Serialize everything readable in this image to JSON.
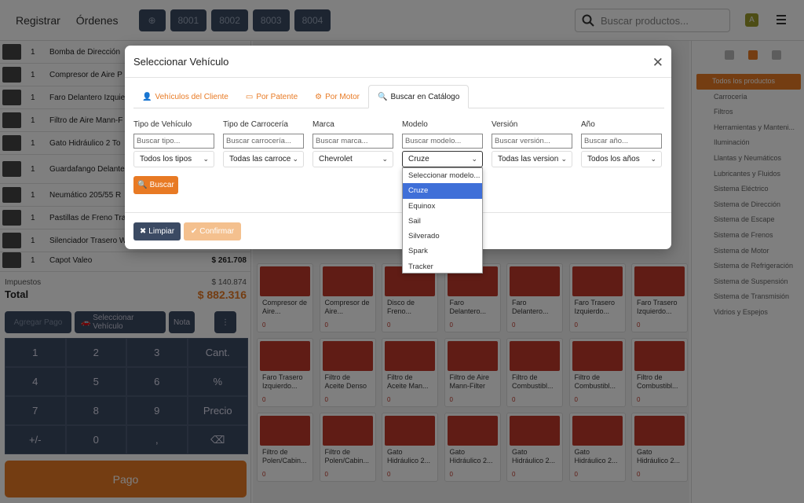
{
  "topbar": {
    "register_label": "Registrar",
    "orders_label": "Órdenes",
    "tickets": [
      "8001",
      "8002",
      "8003",
      "8004"
    ],
    "search_placeholder": "Buscar productos...",
    "avatar_letter": "A"
  },
  "cart": {
    "items": [
      {
        "qty": "1",
        "name": "Bomba de Dirección"
      },
      {
        "qty": "1",
        "name": "Compresor de Aire P"
      },
      {
        "qty": "1",
        "name": "Faro Delantero Izquie"
      },
      {
        "qty": "1",
        "name": "Filtro de Aire Mann-F"
      },
      {
        "qty": "1",
        "name": "Gato Hidráulico 2 To"
      },
      {
        "qty": "1",
        "name": "Guardafango Delante Marelli"
      },
      {
        "qty": "1",
        "name": "Neumático 205/55 R"
      },
      {
        "qty": "1",
        "name": "Pastillas de Freno Tra"
      },
      {
        "qty": "1",
        "name": "Silenciador Trasero W"
      },
      {
        "qty": "1",
        "name": "Capot Valeo",
        "price": "$ 261.708"
      }
    ],
    "taxes_label": "Impuestos",
    "taxes_value": "$ 140.874",
    "total_label": "Total",
    "total_value": "$ 882.316"
  },
  "actions": {
    "add_product": "Agregar Pago",
    "select_vehicle": "Seleccionar Vehículo",
    "note": "Nota",
    "more": "⋮"
  },
  "keypad": {
    "keys": [
      "1",
      "2",
      "3",
      "Cant.",
      "4",
      "5",
      "6",
      "%",
      "7",
      "8",
      "9",
      "Precio",
      "+/-",
      "0",
      ",",
      "⌫"
    ]
  },
  "pay_label": "Pago",
  "products": [
    {
      "name": "Compresor de Aire..."
    },
    {
      "name": "Compresor de Aire..."
    },
    {
      "name": "Disco de Freno..."
    },
    {
      "name": "Faro Delantero..."
    },
    {
      "name": "Faro Delantero..."
    },
    {
      "name": "Faro Trasero Izquierdo..."
    },
    {
      "name": "Faro Trasero Izquierdo..."
    },
    {
      "name": "Faro Trasero Izquierdo..."
    },
    {
      "name": "Filtro de Aceite Denso"
    },
    {
      "name": "Filtro de Aceite Man..."
    },
    {
      "name": "Filtro de Aire Mann-Filter"
    },
    {
      "name": "Filtro de Combustibl..."
    },
    {
      "name": "Filtro de Combustibl..."
    },
    {
      "name": "Filtro de Combustibl..."
    },
    {
      "name": "Filtro de Polen/Cabin..."
    },
    {
      "name": "Filtro de Polen/Cabin..."
    },
    {
      "name": "Gato Hidráulico 2..."
    },
    {
      "name": "Gato Hidráulico 2..."
    },
    {
      "name": "Gato Hidráulico 2..."
    },
    {
      "name": "Gato Hidráulico 2..."
    },
    {
      "name": "Gato Hidráulico 2..."
    }
  ],
  "product_stock": "0",
  "categories": [
    "Todos los productos",
    "Carrocería",
    "Filtros",
    "Herramientas y Manteni...",
    "Iluminación",
    "Llantas y Neumáticos",
    "Lubricantes y Fluidos",
    "Sistema Eléctrico",
    "Sistema de Dirección",
    "Sistema de Escape",
    "Sistema de Frenos",
    "Sistema de Motor",
    "Sistema de Refrigeración",
    "Sistema de Suspensión",
    "Sistema de Transmisión",
    "Vidrios y Espejos"
  ],
  "modal": {
    "title": "Seleccionar Vehículo",
    "tabs": [
      "Vehículos del Cliente",
      "Por Patente",
      "Por Motor",
      "Buscar en Catálogo"
    ],
    "fields": [
      {
        "label": "Tipo de Vehículo",
        "placeholder": "Buscar tipo...",
        "select": "Todos los tipos"
      },
      {
        "label": "Tipo de Carrocería",
        "placeholder": "Buscar carrocería...",
        "select": "Todas las carroce"
      },
      {
        "label": "Marca",
        "placeholder": "Buscar marca...",
        "select": "Chevrolet"
      },
      {
        "label": "Modelo",
        "placeholder": "Buscar modelo...",
        "select": "Cruze"
      },
      {
        "label": "Versión",
        "placeholder": "Buscar versión...",
        "select": "Todas las version"
      },
      {
        "label": "Año",
        "placeholder": "Buscar año...",
        "select": "Todos los años"
      }
    ],
    "search_button": "Buscar",
    "clear_button": "Limpiar",
    "confirm_button": "Confirmar",
    "model_options": [
      "Seleccionar modelo...",
      "Cruze",
      "Equinox",
      "Sail",
      "Silverado",
      "Spark",
      "Tracker"
    ],
    "model_selected": "Cruze"
  },
  "colors": {
    "accent": "#e87a24",
    "dark": "#3b4a63",
    "selected": "#3f6fd8"
  }
}
